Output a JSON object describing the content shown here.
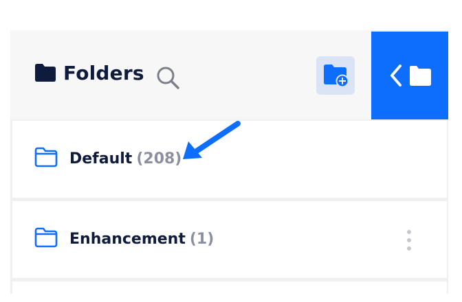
{
  "header": {
    "title": "Folders",
    "icons": {
      "folder": "folder-icon",
      "search": "search-icon",
      "new_folder": "folder-plus-icon",
      "collapse": "chevron-left-folder-icon"
    }
  },
  "folders": [
    {
      "name": "Default",
      "count": "(208)"
    },
    {
      "name": "Enhancement",
      "count": "(1)"
    }
  ],
  "annotation": {
    "arrow": "pointer-arrow",
    "color": "#0d6efd"
  },
  "colors": {
    "accent": "#0d6efd",
    "text_dark": "#0f1b3d",
    "count_gray": "#8a909f",
    "button_bg": "#dbe4f7"
  }
}
